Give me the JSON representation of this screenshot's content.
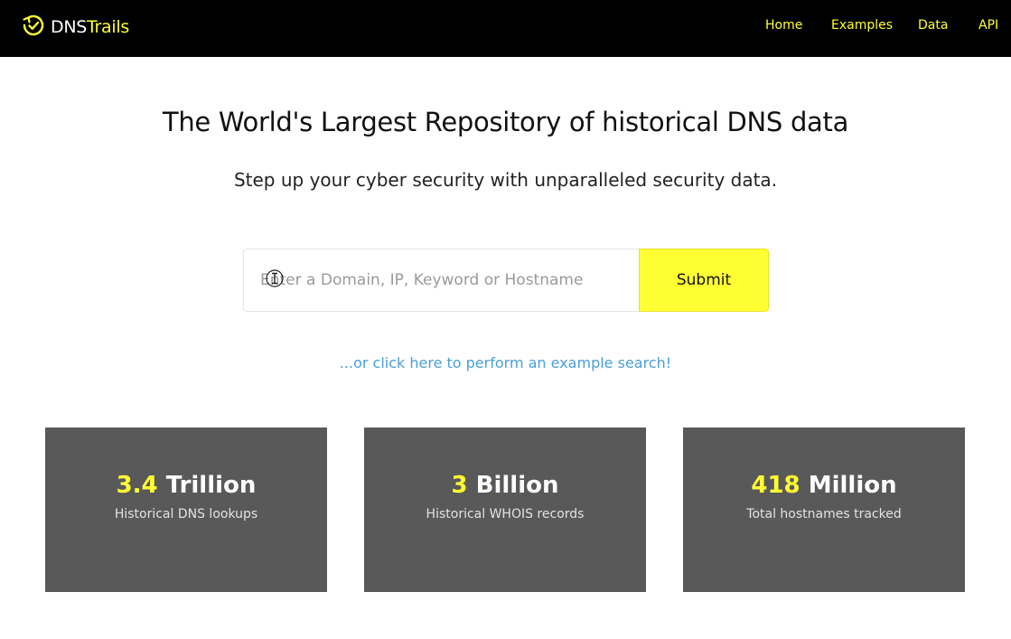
{
  "nav": {
    "logo_prefix": "DNS",
    "logo_suffix": "Trails",
    "links": [
      "Home",
      "Examples",
      "Data",
      "API"
    ]
  },
  "hero": {
    "title": "The World's Largest Repository of historical DNS data",
    "subtitle": "Step up your cyber security with unparalleled security data."
  },
  "search": {
    "value": "",
    "placeholder": "Enter a Domain, IP, Keyword or Hostname",
    "submit_label": "Submit",
    "example_link": "...or click here to perform an example search!"
  },
  "stats": [
    {
      "number": "3.4",
      "unit": "Trillion",
      "label": "Historical DNS lookups"
    },
    {
      "number": "3",
      "unit": "Billion",
      "label": "Historical WHOIS records"
    },
    {
      "number": "418",
      "unit": "Million",
      "label": "Total hostnames tracked"
    }
  ],
  "colors": {
    "accent": "#ffff33",
    "nav_bg": "#000000",
    "card_bg": "#595959",
    "link": "#4a9fd8"
  },
  "icons": {
    "logo": "check-circle-arrow-icon",
    "cursor": "text-cursor-icon"
  }
}
